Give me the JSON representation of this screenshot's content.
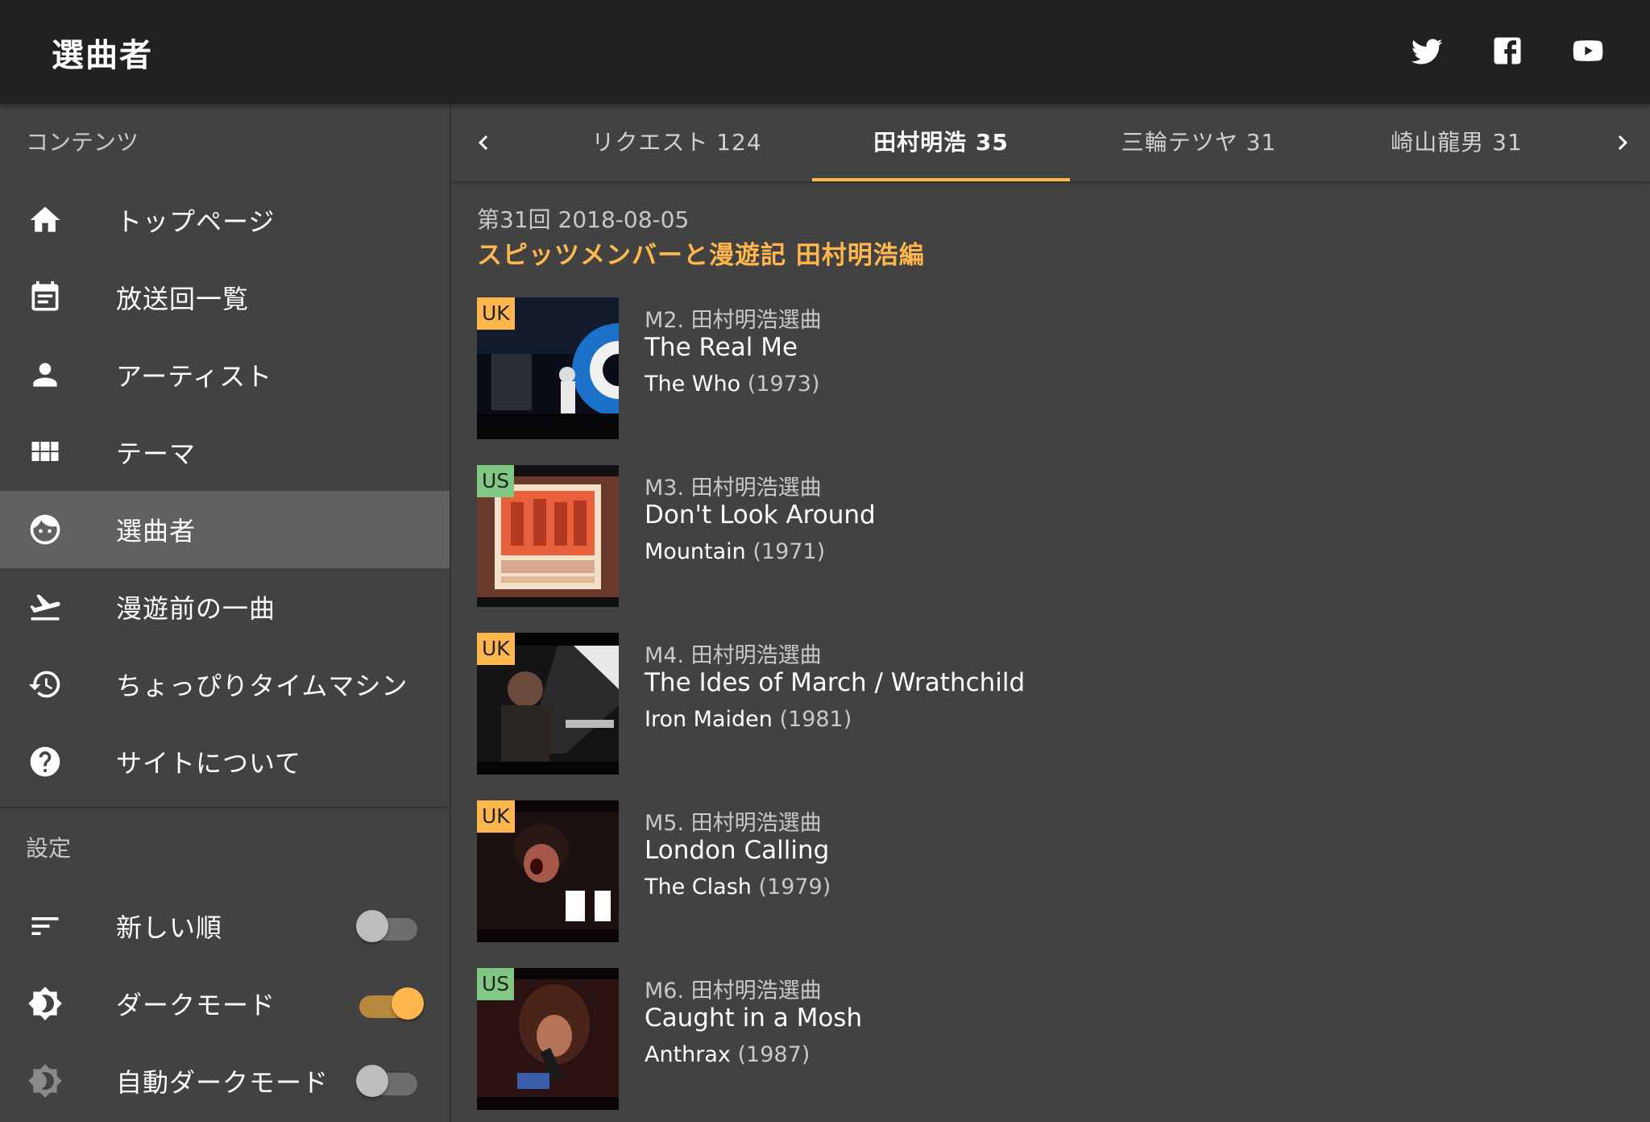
{
  "app": {
    "title": "選曲者"
  },
  "drawer": {
    "contents_header": "コンテンツ",
    "items": [
      {
        "label": "トップページ",
        "icon": "home-icon"
      },
      {
        "label": "放送回一覧",
        "icon": "calendar-list-icon"
      },
      {
        "label": "アーティスト",
        "icon": "person-icon"
      },
      {
        "label": "テーマ",
        "icon": "grid-icon"
      },
      {
        "label": "選曲者",
        "icon": "face-icon",
        "active": true
      },
      {
        "label": "漫遊前の一曲",
        "icon": "airplane-takeoff-icon"
      },
      {
        "label": "ちょっぴりタイムマシン",
        "icon": "history-icon"
      },
      {
        "label": "サイトについて",
        "icon": "help-icon"
      }
    ],
    "settings_header": "設定",
    "settings": [
      {
        "label": "新しい順",
        "icon": "sort-icon",
        "on": false
      },
      {
        "label": "ダークモード",
        "icon": "brightness-icon",
        "on": true
      },
      {
        "label": "自動ダークモード",
        "icon": "auto-brightness-icon",
        "on": false
      }
    ]
  },
  "tabs": [
    {
      "label": "リクエスト 124"
    },
    {
      "label": "田村明浩 35",
      "active": true
    },
    {
      "label": "三輪テツヤ 31"
    },
    {
      "label": "崎山龍男 31"
    }
  ],
  "episode": {
    "date": "第31回 2018-08-05",
    "title": "スピッツメンバーと漫遊記 田村明浩編"
  },
  "tracks": [
    {
      "country": "UK",
      "meta": "M2. 田村明浩選曲",
      "title": "The Real Me",
      "artist": "The Who",
      "year": "(1973)"
    },
    {
      "country": "US",
      "meta": "M3. 田村明浩選曲",
      "title": "Don't Look Around",
      "artist": "Mountain",
      "year": "(1971)"
    },
    {
      "country": "UK",
      "meta": "M4. 田村明浩選曲",
      "title": "The Ides of March / Wrathchild",
      "artist": "Iron Maiden",
      "year": "(1981)"
    },
    {
      "country": "UK",
      "meta": "M5. 田村明浩選曲",
      "title": "London Calling",
      "artist": "The Clash",
      "year": "(1979)"
    },
    {
      "country": "US",
      "meta": "M6. 田村明浩選曲",
      "title": "Caught in a Mosh",
      "artist": "Anthrax",
      "year": "(1987)"
    }
  ],
  "colors": {
    "accent": "#ffb74d",
    "uk_badge": "#ffb74d",
    "us_badge": "#81c784",
    "appbar": "#212121",
    "surface": "#424242",
    "active_item": "#616161"
  }
}
